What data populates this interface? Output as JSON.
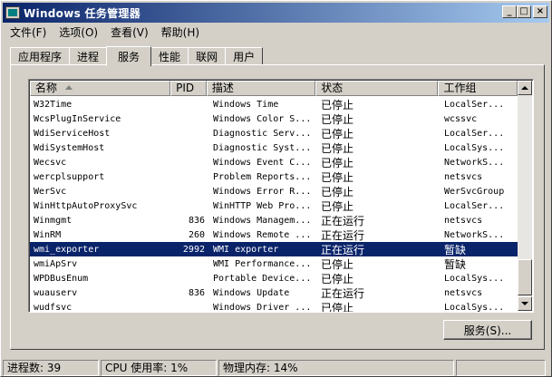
{
  "window": {
    "title": "Windows 任务管理器",
    "controls": {
      "minimize": "_",
      "maximize": "□",
      "close": "×"
    }
  },
  "menu": [
    "文件(F)",
    "选项(O)",
    "查看(V)",
    "帮助(H)"
  ],
  "tabs": [
    {
      "label": "应用程序",
      "active": false
    },
    {
      "label": "进程",
      "active": false
    },
    {
      "label": "服务",
      "active": true
    },
    {
      "label": "性能",
      "active": false
    },
    {
      "label": "联网",
      "active": false
    },
    {
      "label": "用户",
      "active": false
    }
  ],
  "table": {
    "columns": [
      "名称",
      "PID",
      "描述",
      "状态",
      "工作组"
    ],
    "sorted_column": "名称",
    "sort_direction": "ascending",
    "rows": [
      {
        "name": "W32Time",
        "pid": "",
        "desc": "Windows Time",
        "status": "已停止",
        "group": "LocalSer..."
      },
      {
        "name": "WcsPlugInService",
        "pid": "",
        "desc": "Windows Color S...",
        "status": "已停止",
        "group": "wcssvc"
      },
      {
        "name": "WdiServiceHost",
        "pid": "",
        "desc": "Diagnostic Serv...",
        "status": "已停止",
        "group": "LocalSer..."
      },
      {
        "name": "WdiSystemHost",
        "pid": "",
        "desc": "Diagnostic Syst...",
        "status": "已停止",
        "group": "LocalSys..."
      },
      {
        "name": "Wecsvc",
        "pid": "",
        "desc": "Windows Event C...",
        "status": "已停止",
        "group": "NetworkS..."
      },
      {
        "name": "wercplsupport",
        "pid": "",
        "desc": "Problem Reports...",
        "status": "已停止",
        "group": "netsvcs"
      },
      {
        "name": "WerSvc",
        "pid": "",
        "desc": "Windows Error R...",
        "status": "已停止",
        "group": "WerSvcGroup"
      },
      {
        "name": "WinHttpAutoProxySvc",
        "pid": "",
        "desc": "WinHTTP Web Pro...",
        "status": "已停止",
        "group": "LocalSer..."
      },
      {
        "name": "Winmgmt",
        "pid": "836",
        "desc": "Windows Managem...",
        "status": "正在运行",
        "group": "netsvcs"
      },
      {
        "name": "WinRM",
        "pid": "260",
        "desc": "Windows Remote ...",
        "status": "正在运行",
        "group": "NetworkS..."
      },
      {
        "name": "wmi_exporter",
        "pid": "2992",
        "desc": "WMI exporter",
        "status": "正在运行",
        "group": "暂缺",
        "selected": true
      },
      {
        "name": "wmiApSrv",
        "pid": "",
        "desc": "WMI Performance...",
        "status": "已停止",
        "group": "暂缺"
      },
      {
        "name": "WPDBusEnum",
        "pid": "",
        "desc": "Portable Device...",
        "status": "已停止",
        "group": "LocalSys..."
      },
      {
        "name": "wuauserv",
        "pid": "836",
        "desc": "Windows Update",
        "status": "正在运行",
        "group": "netsvcs"
      },
      {
        "name": "wudfsvc",
        "pid": "",
        "desc": "Windows Driver ...",
        "status": "已停止",
        "group": "LocalSys..."
      }
    ]
  },
  "services_button": "服务(S)...",
  "status": {
    "processes": "进程数: 39",
    "cpu": "CPU 使用率: 1%",
    "memory": "物理内存: 14%"
  },
  "colors": {
    "title_start": "#0a246a",
    "title_end": "#a6caf0",
    "selection": "#0a246a",
    "face": "#d4d0c8"
  },
  "icons": [
    "task-manager-app-icon",
    "sort-ascending-arrow-icon",
    "scroll-up-arrow-icon",
    "scroll-down-arrow-icon"
  ]
}
